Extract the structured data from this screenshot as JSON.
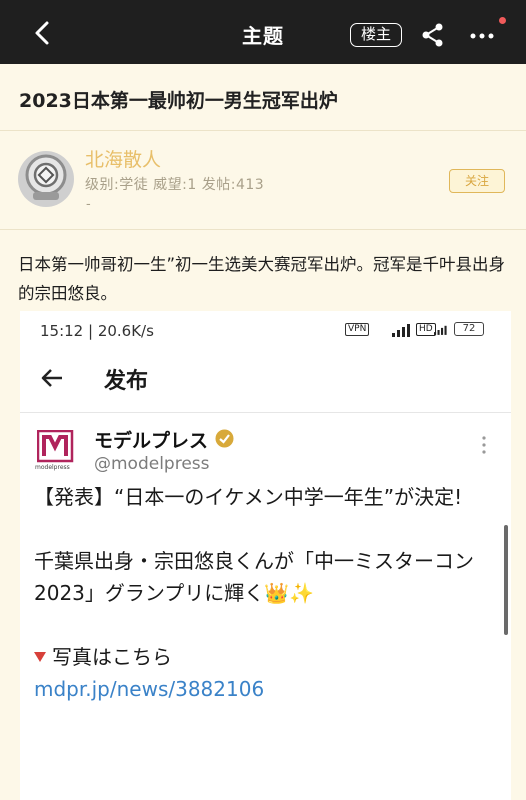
{
  "topbar": {
    "title": "主题",
    "owner_label": "楼主",
    "icons": [
      "back-icon",
      "share-icon",
      "more-icon"
    ],
    "notify_dot_color": "#f05a5a"
  },
  "thread": {
    "title": "2023日本第一最帅初一男生冠军出炉"
  },
  "author": {
    "name": "北海散人",
    "meta": "级别:学徒  威望:1  发帖:413",
    "extra": "-",
    "follow_label": "关注"
  },
  "post": {
    "text": "日本第一帅哥初一生”初一生选美大赛冠军出炉。冠军是千叶县出身的宗田悠良。"
  },
  "screenshot": {
    "status_time": "15:12 | 20.6K/s",
    "status_network": "VPN",
    "status_hd": "HD",
    "battery": "72",
    "page_title": "发布",
    "account_name": "モデルプレス",
    "account_handle": "@modelpress",
    "logo_text": "modelpress",
    "tweet_line1": "【発表】“日本一のイケメン中学一年生”が決定!",
    "tweet_line2": "千葉県出身・宗田悠良くんが「中一ミスターコン2023」グランプリに輝く👑✨",
    "tweet_line3": "写真はこちら",
    "tweet_link": "mdpr.jp/news/3882106"
  },
  "colors": {
    "topbar_bg": "#1f1f1f",
    "page_bg": "#fdf8e8",
    "author_name": "#e8bf6a",
    "follow_accent": "#e0b75a",
    "link": "#3a82c8",
    "modelpress_brand": "#b0245c"
  }
}
